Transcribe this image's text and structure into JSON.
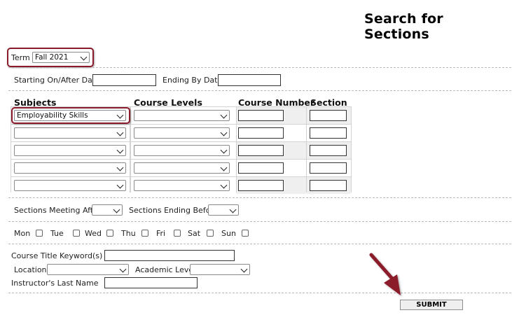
{
  "page": {
    "title": "Search for Sections"
  },
  "term": {
    "label": "Term",
    "value": "Fall 2021"
  },
  "dates": {
    "start_label": "Starting On/After Date",
    "end_label": "Ending By Date"
  },
  "grid": {
    "headers": {
      "subjects": "Subjects",
      "course_levels": "Course Levels",
      "course_number": "Course Number",
      "section": "Section"
    },
    "rows": [
      {
        "subject": "Employability Skills",
        "course_level": ""
      },
      {
        "subject": "",
        "course_level": ""
      },
      {
        "subject": "",
        "course_level": ""
      },
      {
        "subject": "",
        "course_level": ""
      },
      {
        "subject": "",
        "course_level": ""
      }
    ]
  },
  "times": {
    "meeting_after_label": "Sections Meeting After",
    "ending_before_label": "Sections Ending Before"
  },
  "days": [
    "Mon",
    "Tue",
    "Wed",
    "Thu",
    "Fri",
    "Sat",
    "Sun"
  ],
  "filters": {
    "keyword_label": "Course Title Keyword(s)",
    "location_label": "Location",
    "academic_level_label": "Academic Level",
    "instructor_label": "Instructor's Last Name"
  },
  "actions": {
    "submit_label": "SUBMIT"
  },
  "annotations": {
    "highlight_color": "#8b1a2b",
    "arrow_color": "#8b1a2b"
  }
}
